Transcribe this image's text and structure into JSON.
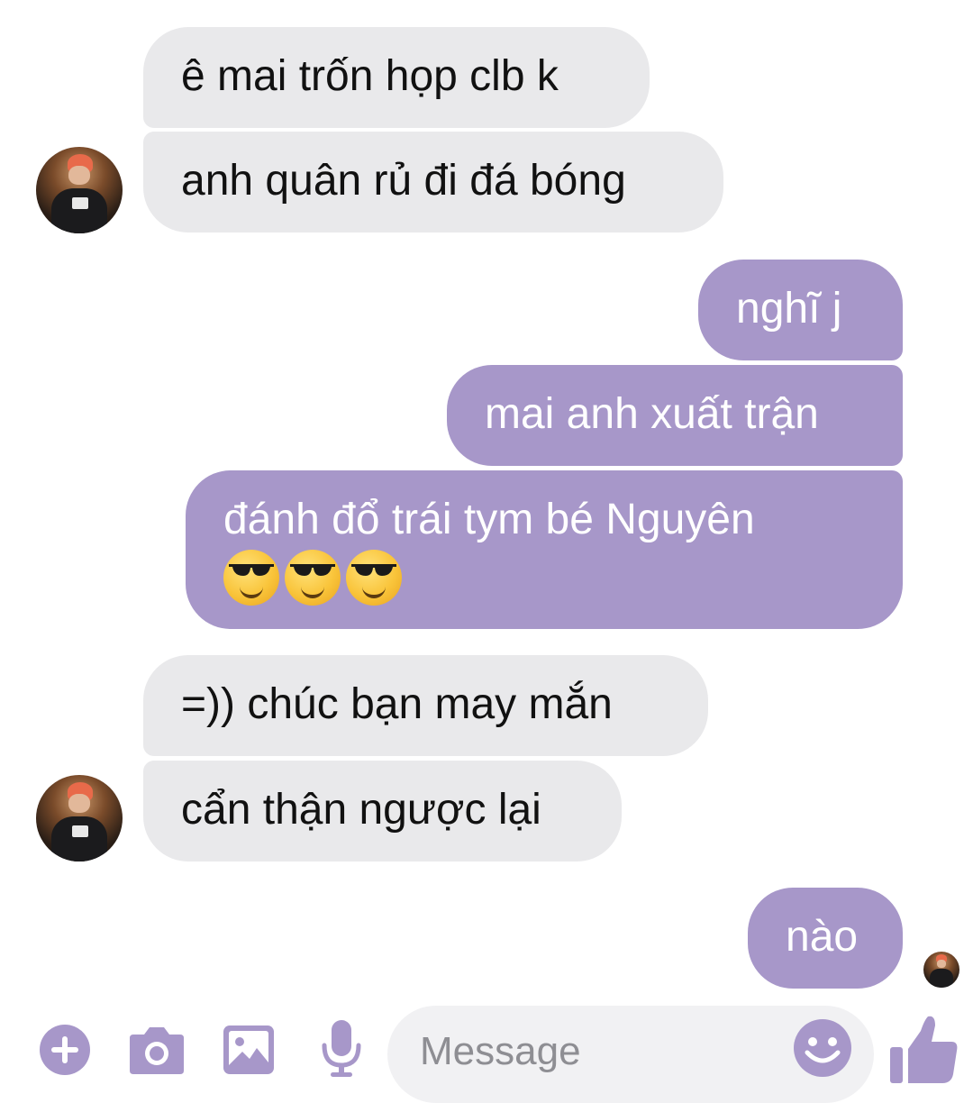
{
  "messages": [
    {
      "text": "ê mai trốn họp clb k",
      "from": "other"
    },
    {
      "text": "anh quân rủ đi đá bóng",
      "from": "other"
    },
    {
      "text": "nghĩ j",
      "from": "me"
    },
    {
      "text": "mai anh xuất trận",
      "from": "me"
    },
    {
      "text": "đánh đổ trái tym bé Nguyên",
      "from": "me",
      "emojis": [
        "smiling-face-with-sunglasses",
        "smiling-face-with-sunglasses",
        "smiling-face-with-sunglasses"
      ]
    },
    {
      "text": "=)) chúc bạn may mắn",
      "from": "other"
    },
    {
      "text": "cẩn thận ngược lại",
      "from": "other"
    },
    {
      "text": "nào",
      "from": "me"
    }
  ],
  "composer": {
    "placeholder": "Message",
    "icons": [
      "plus-icon",
      "camera-icon",
      "image-icon",
      "microphone-icon",
      "emoji-icon",
      "thumbs-up-icon"
    ]
  },
  "colors": {
    "accent": "#a797c9",
    "incoming_bubble": "#e9e9eb",
    "outgoing_text": "#ffffff"
  }
}
